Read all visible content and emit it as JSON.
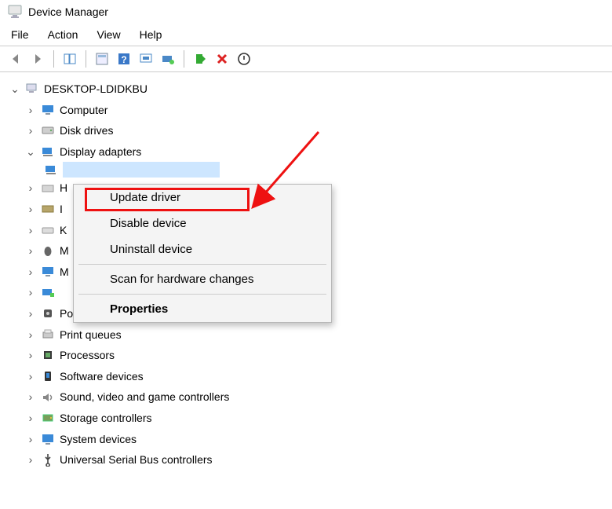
{
  "title": "Device Manager",
  "menu": {
    "file": "File",
    "action": "Action",
    "view": "View",
    "help": "Help"
  },
  "root": "DESKTOP-LDIDKBU",
  "tree": {
    "computer": "Computer",
    "disk_drives": "Disk drives",
    "display_adapters": "Display adapters",
    "ports": "Ports (COM & LPT)",
    "print_queues": "Print queues",
    "processors": "Processors",
    "software_devices": "Software devices",
    "sound": "Sound, video and game controllers",
    "storage": "Storage controllers",
    "system": "System devices",
    "usb": "Universal Serial Bus controllers"
  },
  "hidden_letters": [
    "H",
    "I",
    "K",
    "M",
    "M"
  ],
  "context": {
    "update": "Update driver",
    "disable": "Disable device",
    "uninstall": "Uninstall device",
    "scan": "Scan for hardware changes",
    "properties": "Properties"
  }
}
